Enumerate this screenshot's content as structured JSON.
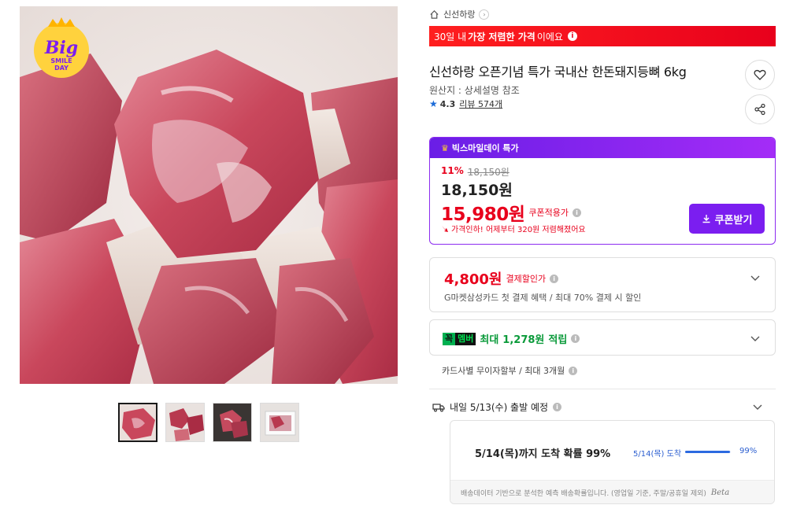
{
  "seller": {
    "name": "신선하랑",
    "chevron": "›"
  },
  "banner": {
    "prefix": "30일 내 ",
    "highlight": "가장 저렴한 가격",
    "suffix": "이에요",
    "info_glyph": "i"
  },
  "product": {
    "title": "신선하랑 오픈기념 특가 국내산 한돈돼지등뼈 6kg",
    "origin": "원산지 : 상세설명 참조",
    "rating": "4.3",
    "review_link": "리뷰 574개"
  },
  "badge": {
    "line1": "Big",
    "line2": "SMILE",
    "line3": "DAY"
  },
  "deal": {
    "header": "빅스마일데이 특가",
    "discount_rate": "11%",
    "original_price": "18,150원",
    "sale_price": "18,150원",
    "coupon_price": "15,980원",
    "coupon_applied_label": "쿠폰적용가",
    "price_down_note": "가격인하! 어제부터 320원 저렴해졌어요",
    "coupon_button": "쿠폰받기"
  },
  "card_discount": {
    "price": "4,800원",
    "label": "결제할인가",
    "description": "G마켓삼성카드 첫 결제 혜택 / 최대 70% 결제 시 할인"
  },
  "membership": {
    "logo_k": "꼭",
    "logo_m": "멤버",
    "prefix": "최대",
    "amount": "1,278원",
    "suffix": "적립"
  },
  "installment": "카드사별 무이자할부 / 최대 3개월",
  "shipping": {
    "text": "내일 5/13(수) 출발 예정"
  },
  "arrival": {
    "headline": "5/14(목)까지 도착 확률 99%",
    "chart_label": "5/14(목) 도착",
    "probability": 0.99,
    "probability_label": "99%",
    "footer": "배송데이터 기반으로 분석한 예측 배송확률입니다. (영업일 기준, 주말/공휴일 제외)",
    "beta": "Beta"
  },
  "colors": {
    "red": "#e8001c",
    "purple": "#7b1ef0",
    "green": "#0a9a3a",
    "blue": "#2c6ae0"
  }
}
